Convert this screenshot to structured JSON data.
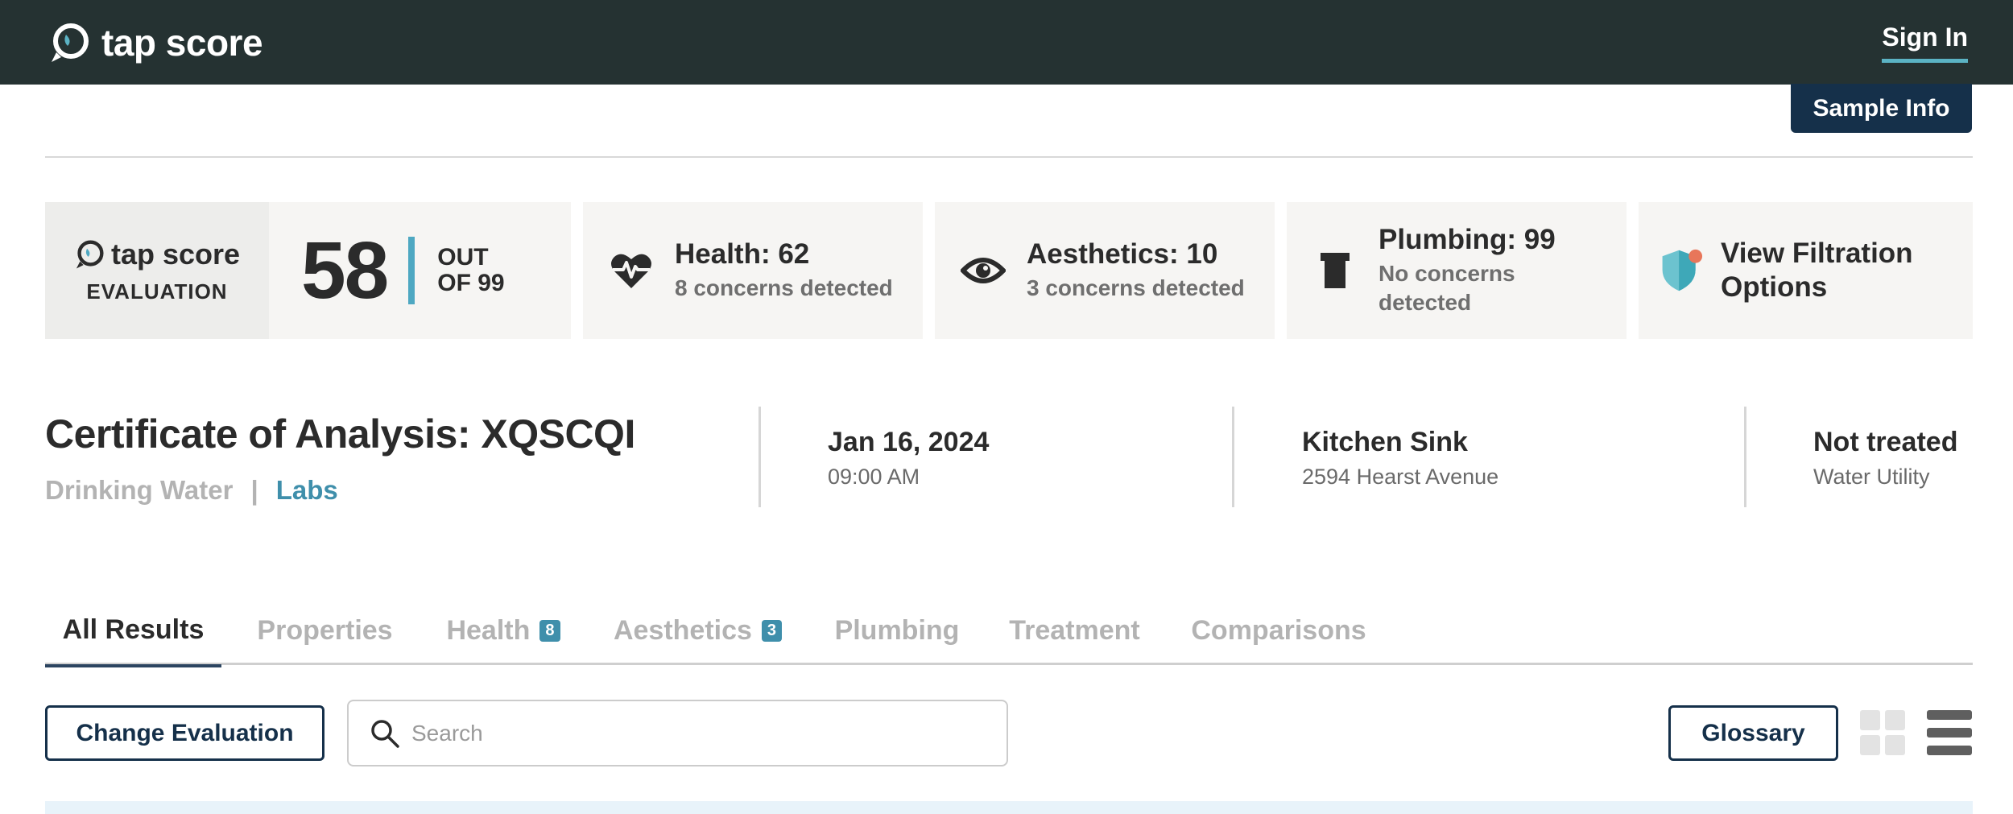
{
  "header": {
    "brand": "tap score",
    "signin_label": "Sign In",
    "colors": {
      "bar": "#253232",
      "accent": "#5bb3c4"
    }
  },
  "sample_info_label": "Sample Info",
  "evaluation": {
    "brand": "tap score",
    "label": "EVALUATION",
    "score": "58",
    "out_of_line1": "OUT",
    "out_of_line2": "OF 99"
  },
  "metrics": {
    "health": {
      "title": "Health: 62",
      "sub": "8 concerns detected",
      "icon": "heartbeat-icon"
    },
    "aesthetics": {
      "title": "Aesthetics: 10",
      "sub": "3 concerns detected",
      "icon": "eye-icon"
    },
    "plumbing": {
      "title": "Plumbing: 99",
      "sub_line1": "No concerns",
      "sub_line2": "detected",
      "icon": "pipe-icon"
    },
    "filtration": {
      "line1": "View Filtration",
      "line2": "Options",
      "icon": "shield-icon"
    }
  },
  "certificate": {
    "title": "Certificate of Analysis: XQSCQI",
    "type": "Drinking Water",
    "separator": "|",
    "link": "Labs"
  },
  "info": {
    "date": "Jan 16, 2024",
    "time": "09:00 AM",
    "location": "Kitchen Sink",
    "address": "2594 Hearst Avenue",
    "treatment": "Not treated",
    "source": "Water Utility"
  },
  "tabs": [
    {
      "label": "All Results",
      "active": true
    },
    {
      "label": "Properties"
    },
    {
      "label": "Health",
      "badge": "8"
    },
    {
      "label": "Aesthetics",
      "badge": "3"
    },
    {
      "label": "Plumbing"
    },
    {
      "label": "Treatment"
    },
    {
      "label": "Comparisons"
    }
  ],
  "toolbar": {
    "change_label": "Change Evaluation",
    "search_placeholder": "Search",
    "glossary_label": "Glossary"
  }
}
